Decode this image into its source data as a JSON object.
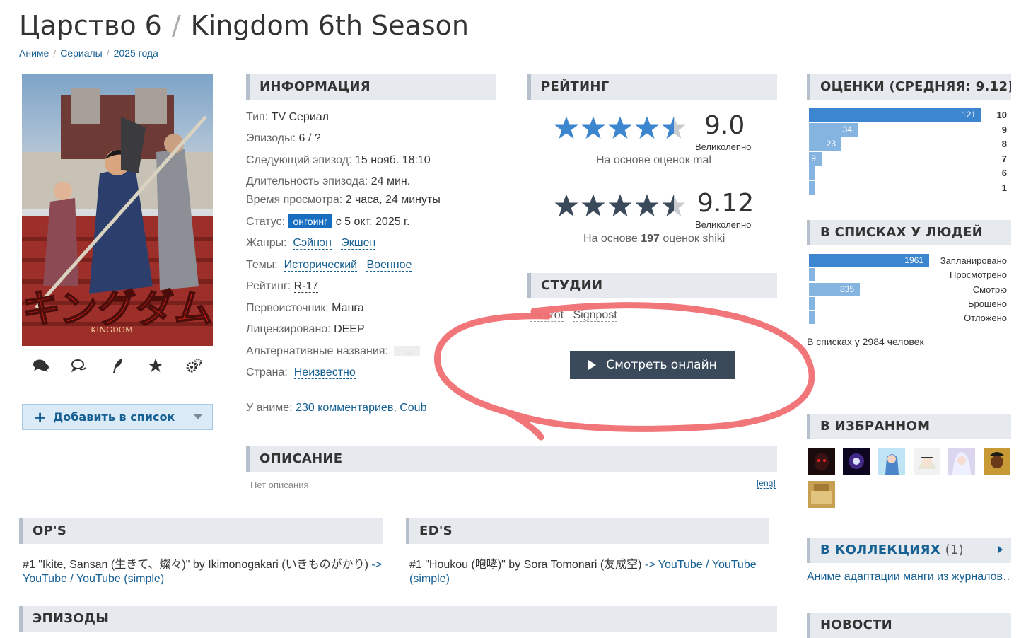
{
  "title": {
    "ru": "Царство 6",
    "sep": "/",
    "en": "Kingdom 6th Season"
  },
  "breadcrumbs": [
    "Аниме",
    "Сериалы",
    "2025 года"
  ],
  "poster": {
    "logo_text": "キングダム",
    "logo_sub": "KINGDOM"
  },
  "icons": [
    "comments-icon",
    "reviews-icon",
    "quill-icon",
    "star-icon",
    "gears-icon"
  ],
  "add_list": {
    "label": "Добавить в список"
  },
  "info": {
    "heading": "ИНФОРМАЦИЯ",
    "type_k": "Тип:",
    "type_v": "TV Сериал",
    "episodes_k": "Эпизоды:",
    "episodes_v": "6 / ?",
    "next_k": "Следующий эпизод:",
    "next_v": "15 нояб. 18:10",
    "duration_k": "Длительность эпизода:",
    "duration_v": "24 мин.",
    "watch_k": "Время просмотра:",
    "watch_v": "2 часа, 24 минуты",
    "status_k": "Статус:",
    "status_badge": "онгоинг",
    "status_v": "с 5 окт. 2025 г.",
    "genres_k": "Жанры:",
    "genre1": "Сэйнэн",
    "genre2": "Экшен",
    "themes_k": "Темы:",
    "theme1": "Исторический",
    "theme2": "Военное",
    "rating_k": "Рейтинг:",
    "rating_v": "R-17",
    "source_k": "Первоисточник:",
    "source_v": "Манга",
    "license_k": "Лицензировано:",
    "license_v": "DEEP",
    "alt_k": "Альтернативные названия:",
    "alt_v": "…",
    "country_k": "Страна:",
    "country_v": "Неизвестно",
    "anime_k": "У аниме:",
    "comments_v": "230 комментариев",
    "comma": ",",
    "coub_v": "Coub"
  },
  "rating": {
    "heading": "РЕЙТИНГ",
    "mal_score": "9.0",
    "mal_verdict": "Великолепно",
    "mal_note": "На основе оценок mal",
    "shiki_score": "9.12",
    "shiki_verdict": "Великолепно",
    "shiki_note_pre": "На основе",
    "shiki_count": "197",
    "shiki_note_post": "оценок shiki",
    "stars_fraction": 0.9,
    "mal_star_color": "#3c85cf",
    "shiki_star_color": "#3b4a5a"
  },
  "studios": {
    "heading": "СТУДИИ",
    "items": [
      "Pierrot",
      "Signpost"
    ]
  },
  "watch_online": "Смотреть онлайн",
  "description": {
    "heading": "ОПИСАНИЕ",
    "text": "Нет описания",
    "eng": "[eng]"
  },
  "scores": {
    "heading": "ОЦЕНКИ (СРЕДНЯЯ: 9.12)",
    "rows": [
      {
        "label": "10",
        "count": "121",
        "value": 121
      },
      {
        "label": "9",
        "count": "34",
        "value": 34
      },
      {
        "label": "8",
        "count": "23",
        "value": 23
      },
      {
        "label": "7",
        "count": "9",
        "value": 9
      },
      {
        "label": "6",
        "count": "",
        "value": 2
      },
      {
        "label": "1",
        "count": "",
        "value": 2
      }
    ]
  },
  "in_lists": {
    "heading": "В СПИСКАХ У ЛЮДЕЙ",
    "rows": [
      {
        "label": "Запланировано",
        "count": "1961",
        "value": 1961
      },
      {
        "label": "Просмотрено",
        "count": "",
        "value": 10
      },
      {
        "label": "Смотрю",
        "count": "835",
        "value": 835
      },
      {
        "label": "Брошено",
        "count": "",
        "value": 20
      },
      {
        "label": "Отложено",
        "count": "",
        "value": 20
      }
    ],
    "total": "В списках у 2984 человек"
  },
  "favorites": {
    "heading": "В ИЗБРАННОМ"
  },
  "collections": {
    "heading": "В КОЛЛЕКЦИЯХ",
    "count": "(1)",
    "item": "Аниме адаптации манги из журналов…"
  },
  "news": {
    "heading": "НОВОСТИ"
  },
  "ops": {
    "heading": "OP'S",
    "line1": "#1 \"Ikite, Sansan (生きて、燦々)\" by Ikimonogakari (いきものがかり)",
    "arrow": "->",
    "yt1": "YouTube",
    "slash": "/",
    "yt2": "YouTube (simple)"
  },
  "eds": {
    "heading": "ED'S",
    "line1": "#1 \"Houkou (咆哮)\" by Sora Tomonari (友成空)",
    "arrow": "->",
    "yt1": "YouTube",
    "slash": "/",
    "yt2": "YouTube",
    "yt2b": "(simple)"
  },
  "episodes": {
    "heading": "ЭПИЗОДЫ"
  },
  "colors": {
    "bar_primary": "#3c85cf",
    "bar_secondary": "#86b4e0",
    "annotation": "#f06f73"
  }
}
